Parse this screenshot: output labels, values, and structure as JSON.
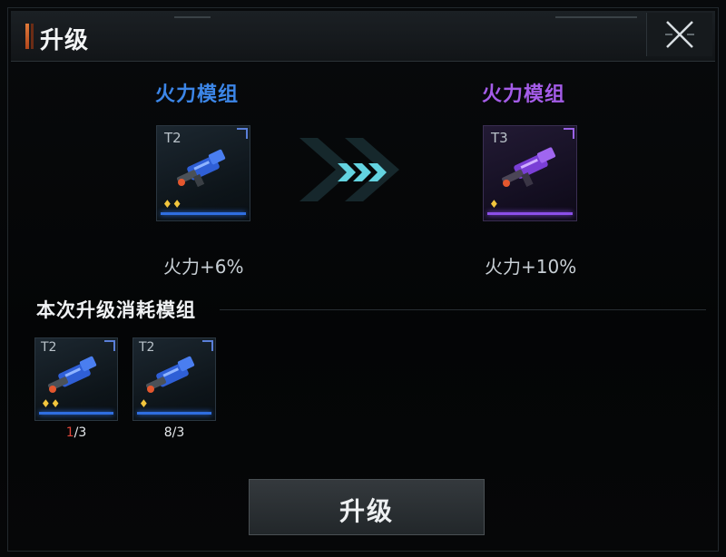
{
  "header": {
    "title": "升级"
  },
  "current": {
    "name": "火力模组",
    "tier": "T2",
    "stat": "火力+6%",
    "stars": "♦♦",
    "color": "#3c86e8"
  },
  "upgraded": {
    "name": "火力模组",
    "tier": "T3",
    "stat": "火力+10%",
    "stars": "♦",
    "color": "#a45ce8"
  },
  "consume": {
    "title": "本次升级消耗模组",
    "items": [
      {
        "tier": "T2",
        "stars": "♦♦",
        "owned": "1",
        "required": "/3"
      },
      {
        "tier": "T2",
        "stars": "♦",
        "owned": "8",
        "required": "/3"
      }
    ]
  },
  "action": {
    "upgrade_label": "升级"
  },
  "icons": {
    "close": "close-icon",
    "arrow": "chevrons-right-icon",
    "weapon": "weapon-module-icon"
  }
}
